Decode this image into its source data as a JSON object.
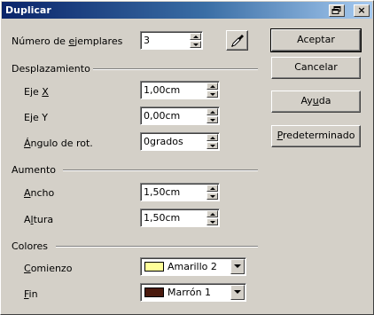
{
  "window": {
    "title": "Duplicar",
    "close_glyph": "×"
  },
  "copies": {
    "label_pre": "Número de ",
    "label_key": "e",
    "label_post": "jemplares",
    "value": "3"
  },
  "displacement": {
    "section_label": "Desplazamiento",
    "x": {
      "label_pre": "Eje ",
      "label_key": "X",
      "label_post": "",
      "value": "1,00cm"
    },
    "y": {
      "label_pre": "E",
      "label_key": "j",
      "label_post": "e Y",
      "value": "0,00cm"
    },
    "angle": {
      "label_pre": "",
      "label_key": "Á",
      "label_post": "ngulo de rot.",
      "value": "0grados"
    }
  },
  "enlargement": {
    "section_label": "Aumento",
    "width": {
      "label_pre": "",
      "label_key": "A",
      "label_post": "ncho",
      "value": "1,50cm"
    },
    "height": {
      "label_pre": "A",
      "label_key": "l",
      "label_post": "tura",
      "value": "1,50cm"
    }
  },
  "colors": {
    "section_label": "Colores",
    "start": {
      "label_pre": "",
      "label_key": "C",
      "label_post": "omienzo",
      "value": "Amarillo 2",
      "swatch": "#ffff99"
    },
    "end": {
      "label_pre": "",
      "label_key": "F",
      "label_post": "in",
      "value": "Marrón 1",
      "swatch": "#4a1a0e"
    }
  },
  "buttons": {
    "ok": "Aceptar",
    "cancel": "Cancelar",
    "help_pre": "Ay",
    "help_key": "u",
    "help_post": "da",
    "default_pre": "",
    "default_key": "P",
    "default_post": "redeterminado"
  }
}
